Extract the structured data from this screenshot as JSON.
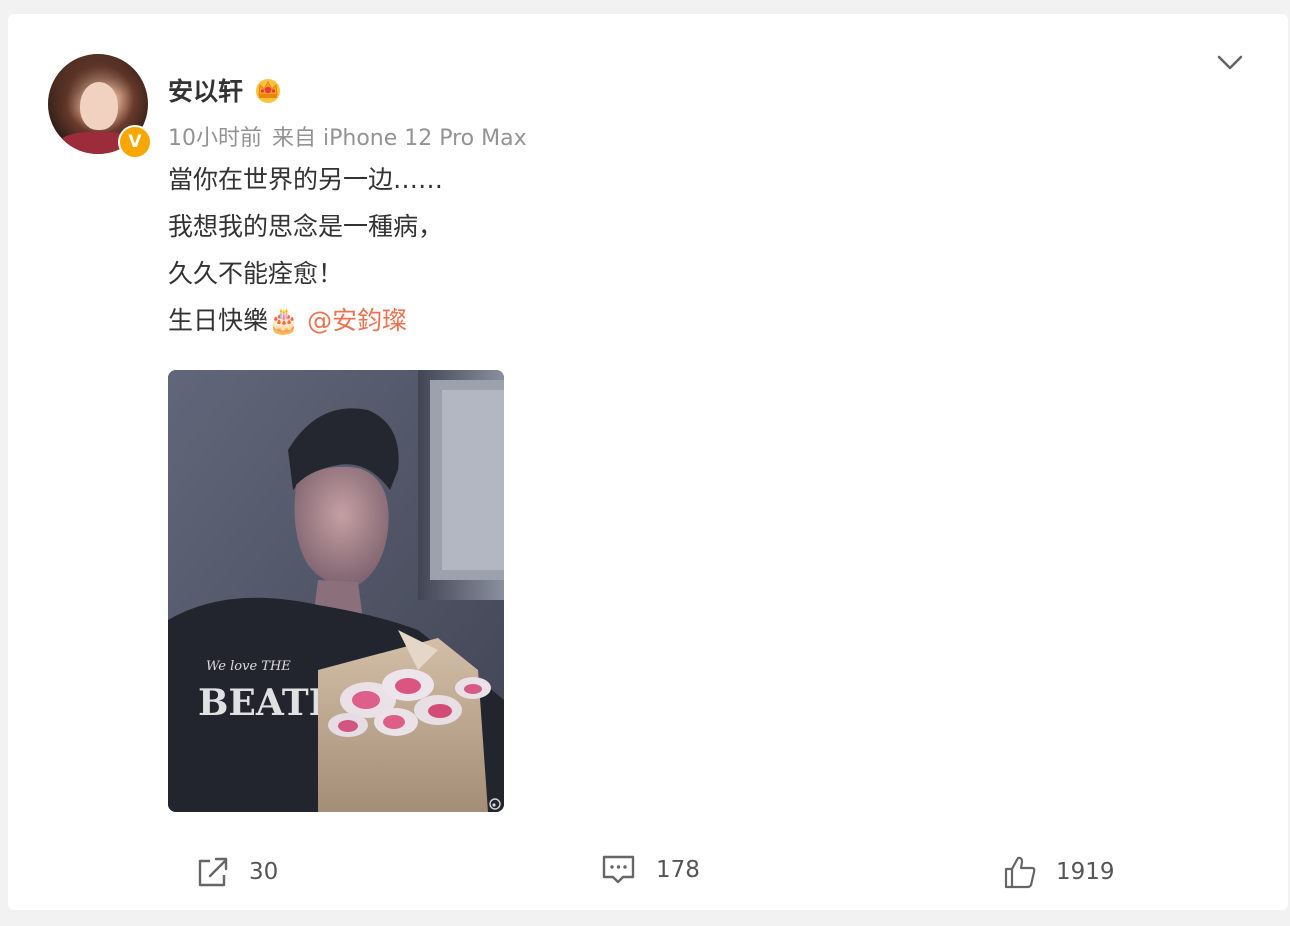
{
  "post": {
    "author": {
      "name": "安以轩",
      "verified_badge": "V",
      "badge_icon": "crown-icon",
      "verified_color": "#f7a700"
    },
    "meta": {
      "time": "10小时前",
      "source": "来自 iPhone 12 Pro Max"
    },
    "content": {
      "lines": [
        "當你在世界的另一边……",
        "我想我的思念是一種病，",
        "久久不能痊愈！",
        "生日快樂🎂"
      ],
      "mention": "@安鈞璨",
      "mention_color": "#eb7350"
    },
    "image": {
      "shirt_text_line1": "We love THE",
      "shirt_text_line2": "BEATLE",
      "watermark_icon": "weibo-watermark-icon"
    },
    "actions": {
      "repost_count": "30",
      "comment_count": "178",
      "like_count": "1919"
    },
    "menu_icon": "chevron-down-icon"
  }
}
